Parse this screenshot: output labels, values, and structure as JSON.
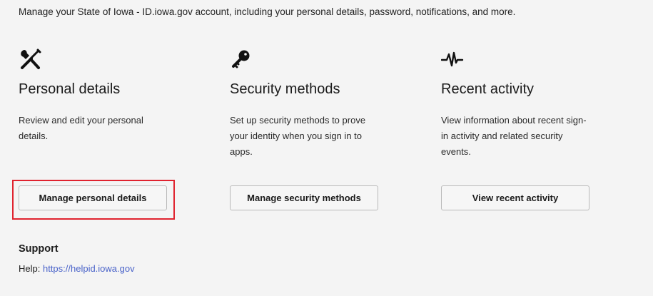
{
  "intro": "Manage your State of Iowa - ID.iowa.gov account, including your personal details, password, notifications, and more.",
  "cards": [
    {
      "icon": "tools-icon",
      "title": "Personal details",
      "description": "Review and edit your personal details.",
      "button_label": "Manage personal details"
    },
    {
      "icon": "key-icon",
      "title": "Security methods",
      "description": "Set up security methods to prove your identity when you sign in to apps.",
      "button_label": "Manage security methods"
    },
    {
      "icon": "activity-icon",
      "title": "Recent activity",
      "description": "View information about recent sign-in activity and related security events.",
      "button_label": "View recent activity"
    }
  ],
  "support": {
    "title": "Support",
    "help_prefix": "Help: ",
    "help_link": "https://helpid.iowa.gov"
  },
  "colors": {
    "background": "#f4f4f4",
    "link": "#4a63c9",
    "highlight": "#e0232f"
  }
}
